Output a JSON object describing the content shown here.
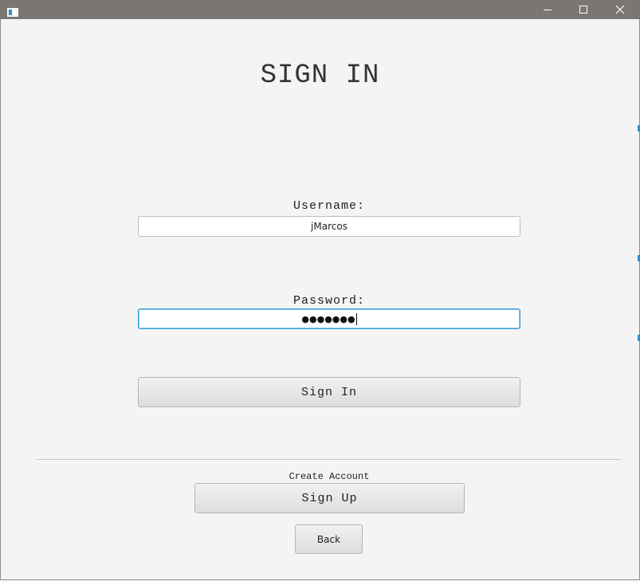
{
  "window": {
    "icon": "java-app-icon",
    "controls": [
      "minimize-icon",
      "maximize-icon",
      "close-icon"
    ]
  },
  "page": {
    "title": "SIGN IN"
  },
  "form": {
    "username_label": "Username:",
    "username_value": "jMarcos",
    "password_label": "Password:",
    "password_masked": "●●●●●●●",
    "signin_label": "Sign In"
  },
  "footer": {
    "create_account_label": "Create Account",
    "signup_label": "Sign Up",
    "back_label": "Back"
  },
  "colors": {
    "titlebar": "#7b7574",
    "background": "#f4f4f4",
    "focus": "#2f9bd9"
  }
}
